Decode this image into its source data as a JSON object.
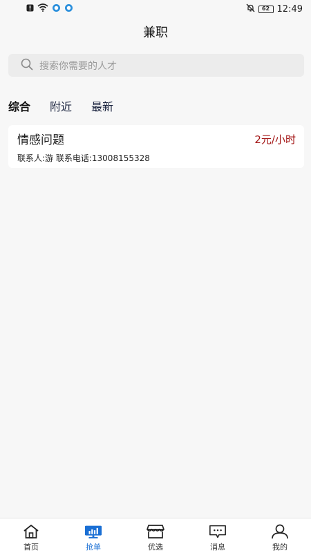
{
  "status_bar": {
    "time": "12:49",
    "battery": "62",
    "icons": [
      "alert-icon",
      "wifi-icon",
      "app-icon-1",
      "app-icon-2",
      "mute-icon",
      "battery-icon"
    ]
  },
  "header": {
    "title": "兼职"
  },
  "search": {
    "placeholder": "搜索你需要的人才"
  },
  "tabs": [
    {
      "label": "综合",
      "active": true
    },
    {
      "label": "附近",
      "active": false
    },
    {
      "label": "最新",
      "active": false
    }
  ],
  "list": [
    {
      "title": "情感问题",
      "price": "2元/小时",
      "contact": "联系人:游 联系电话:13008155328"
    }
  ],
  "bottom_nav": [
    {
      "label": "首页",
      "icon": "home-icon",
      "active": false
    },
    {
      "label": "抢单",
      "icon": "grab-order-icon",
      "active": true
    },
    {
      "label": "优选",
      "icon": "store-icon",
      "active": false
    },
    {
      "label": "消息",
      "icon": "message-icon",
      "active": false
    },
    {
      "label": "我的",
      "icon": "user-icon",
      "active": false
    }
  ],
  "colors": {
    "accent": "#1a6fd4",
    "price": "#a31515",
    "background": "#f7f7f7"
  }
}
